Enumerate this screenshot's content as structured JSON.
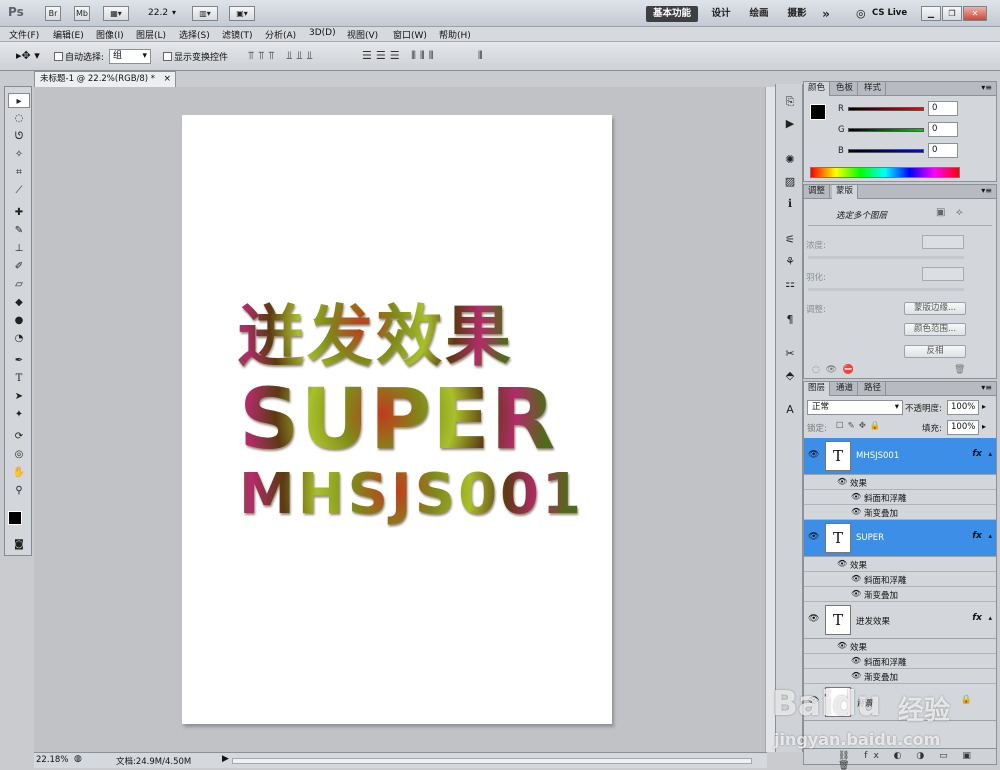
{
  "app": {
    "logo": "Ps",
    "zoom_select": "22.2",
    "workspaces": [
      "基本功能",
      "设计",
      "绘画",
      "摄影"
    ],
    "more": "»",
    "cslive": "CS Live"
  },
  "menu": [
    "文件(F)",
    "编辑(E)",
    "图像(I)",
    "图层(L)",
    "选择(S)",
    "滤镜(T)",
    "分析(A)",
    "3D(D)",
    "视图(V)",
    "窗口(W)",
    "帮助(H)"
  ],
  "options": {
    "auto_select": "自动选择:",
    "group_value": "组",
    "show_transform": "显示变换控件"
  },
  "document": {
    "tab": "未标题-1 @ 22.2%(RGB/8) *",
    "close": "×"
  },
  "artwork": {
    "line1": "迸发效果",
    "line2": "SUPER",
    "line3": "MHSJS001"
  },
  "status": {
    "zoom": "22.18%",
    "doc": "文档:24.9M/4.50M"
  },
  "color_panel": {
    "tabs": [
      "颜色",
      "色板",
      "样式"
    ],
    "r_label": "R",
    "g_label": "G",
    "b_label": "B",
    "r": "0",
    "g": "0",
    "b": "0"
  },
  "masks_panel": {
    "tabs": [
      "调整",
      "蒙版"
    ],
    "selected": "选定多个图层",
    "density": "浓度:",
    "feather": "羽化:",
    "adjust": "调整:",
    "btn_edge": "蒙版边缘...",
    "btn_range": "颜色范围...",
    "btn_invert": "反相"
  },
  "layers_panel": {
    "tabs": [
      "图层",
      "通道",
      "路径"
    ],
    "blend": "正常",
    "opacity_label": "不透明度:",
    "opacity": "100%",
    "lock_label": "锁定:",
    "fill_label": "填充:",
    "fill": "100%",
    "layers": [
      {
        "name": "MHSJS001",
        "effects": "效果",
        "fx1": "斜面和浮雕",
        "fx2": "渐变叠加"
      },
      {
        "name": "SUPER",
        "effects": "效果",
        "fx1": "斜面和浮雕",
        "fx2": "渐变叠加"
      },
      {
        "name": "迸发效果",
        "effects": "效果",
        "fx1": "斜面和浮雕",
        "fx2": "渐变叠加"
      }
    ],
    "background": "背景",
    "fx_badge": "fx",
    "thumb_glyph": "T"
  },
  "watermark": {
    "brand": "Baidu",
    "cn": "经验",
    "url": "jingyan.baidu.com"
  }
}
